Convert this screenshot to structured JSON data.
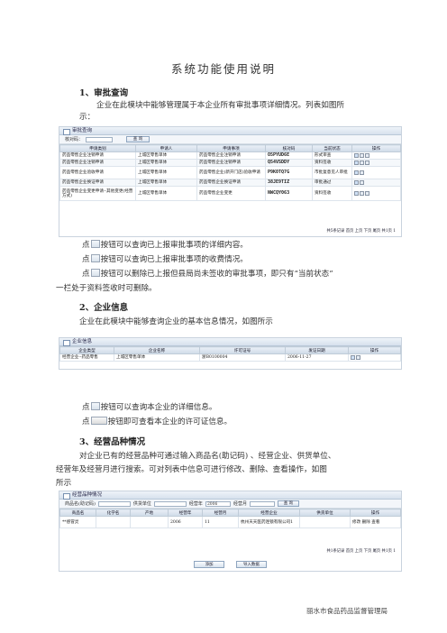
{
  "title": "系统功能使用说明",
  "s1": {
    "heading": "1、审批查询",
    "intro": "企业在此模块中能够管理属于本企业所有审批事项详细情况。列表如图所示：",
    "shot": {
      "bar_title": "审批查询",
      "filter_label": "核对码：",
      "search_btn": "查 询",
      "columns": [
        "申请类别",
        "申请人",
        "申请事项",
        "核对码",
        "当前状态",
        "操作"
      ],
      "rows": [
        [
          "药品零售企业注销申请",
          "上城区零售单体",
          "药品零售企业注销申请",
          "O5PYUD6E",
          "形式审查"
        ],
        [
          "药品零售企业注销申请",
          "上城区零售单体",
          "药品零售企业注销申请",
          "Q54VSDDY",
          "资料签收"
        ],
        [
          "药品零售企业验收申请",
          "上城区零售单体",
          "药品零售企业(新开门店)验收申请",
          "P9K0TQ7G",
          "市批复意见人审批"
        ],
        [
          "药品零售企业换证申请",
          "上城区零售单体",
          "药品零售企业换证申请",
          "38JE9TIZ",
          "审批通过"
        ],
        [
          "药品零售企业变更申请--其他变更(经营方式)",
          "上城区零售单体",
          "药品零售企业变更",
          "NWCQY063",
          "资料签收"
        ]
      ],
      "pager": "共5条记录  首页 上页 下页 尾页  共1页  1"
    },
    "bullets": [
      {
        "pre": "点",
        "post": "按钮可以查询已上报审批事项的详细内容。"
      },
      {
        "pre": "点",
        "post": "按钮可以查询已上报审批事项的收费情况。"
      },
      {
        "pre": "点",
        "post": "按钮可以删除已上报但县局尚未签收的审批事项，即只有“当前状态”"
      },
      {
        "pre": "",
        "post": "一栏处于资料签收时可删除。"
      }
    ]
  },
  "s2": {
    "heading": "2、企业信息",
    "intro": "企业在此模块中能够查询企业的基本信息情况，如图所示",
    "shot": {
      "bar_title": "企业信息",
      "columns": [
        "企业类型",
        "企业名称",
        "许可证号",
        "发证日期",
        "操作"
      ],
      "row": [
        "经营企业--药品零售",
        "上城区零售单体",
        "浙B0100004",
        "2006-11-27"
      ]
    },
    "bullets": [
      {
        "pre": "点",
        "post": "按钮可以查询本企业的详细信息。"
      },
      {
        "pre": "点",
        "post": "按钮即可查看本企业的许可证信息。"
      }
    ]
  },
  "s3": {
    "heading": "3、经营品种情况",
    "intro1": "对企业已有的经营品种可通过输入商品名(助记码) 、经营企业、供货单位、",
    "intro2": "经营年及经营月进行搜索。可对列表中信息可进行修改、删除、查看操作，如图",
    "intro3": "所示",
    "shot": {
      "bar_title": "经营品种情况",
      "f1": "商品名(助记码)",
      "f2": "供货单位",
      "f3": "经营年",
      "year": "2006",
      "f4": "经营月",
      "search_btn": "查 询",
      "columns": [
        "商品名",
        "化学名",
        "产地",
        "经营年",
        "经营月",
        "经营企业",
        "供货单位",
        "操作"
      ],
      "row": [
        "**感冒灵",
        "",
        "",
        "2006",
        "11",
        "杭州天天医药连锁有限公司1",
        "",
        "修改 删除 查看"
      ],
      "pager": "共1条记录  首页 上页 下页 尾页  共1页  1",
      "btn_add": "添加",
      "btn_import": "导入数据"
    }
  },
  "footer": "丽水市食品药品监督管理局"
}
